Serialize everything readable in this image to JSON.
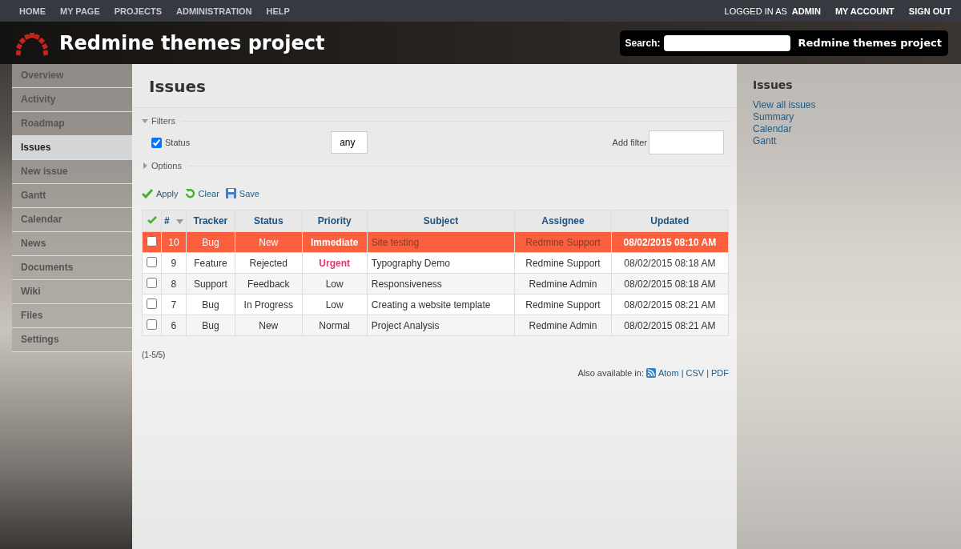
{
  "top_menu": {
    "items": [
      "HOME",
      "MY PAGE",
      "PROJECTS",
      "ADMINISTRATION",
      "HELP"
    ],
    "logged_in_label": "LOGGED IN AS",
    "user": "ADMIN",
    "account_items": [
      "MY ACCOUNT",
      "SIGN OUT"
    ]
  },
  "header": {
    "title": "Redmine themes project",
    "search_label": "Search:",
    "project_jump": "Redmine themes project"
  },
  "main_menu": [
    {
      "label": "Overview",
      "selected": false
    },
    {
      "label": "Activity",
      "selected": false
    },
    {
      "label": "Roadmap",
      "selected": false
    },
    {
      "label": "Issues",
      "selected": true
    },
    {
      "label": "New issue",
      "selected": false
    },
    {
      "label": "Gantt",
      "selected": false
    },
    {
      "label": "Calendar",
      "selected": false
    },
    {
      "label": "News",
      "selected": false
    },
    {
      "label": "Documents",
      "selected": false
    },
    {
      "label": "Wiki",
      "selected": false
    },
    {
      "label": "Files",
      "selected": false
    },
    {
      "label": "Settings",
      "selected": false
    }
  ],
  "page_title": "Issues",
  "filters": {
    "legend": "Filters",
    "expanded": true,
    "status_label": "Status",
    "status_checked": true,
    "status_value": "any",
    "add_filter_label": "Add filter"
  },
  "options": {
    "legend": "Options",
    "expanded": false
  },
  "actions": [
    "Apply",
    "Clear",
    "Save"
  ],
  "table": {
    "columns": [
      "#",
      "Tracker",
      "Status",
      "Priority",
      "Subject",
      "Assignee",
      "Updated"
    ],
    "rows": [
      {
        "kind": "immediate",
        "checked": false,
        "cells": [
          "10",
          "Bug",
          "New",
          "Immediate",
          "Site testing",
          "Redmine Support",
          "08/02/2015 08:10 AM"
        ]
      },
      {
        "kind": "urgent",
        "checked": false,
        "cells": [
          "9",
          "Feature",
          "Rejected",
          "Urgent",
          "Typography Demo",
          "Redmine Support",
          "08/02/2015 08:18 AM"
        ]
      },
      {
        "kind": "normal",
        "checked": false,
        "cells": [
          "8",
          "Support",
          "Feedback",
          "Low",
          "Responsiveness",
          "Redmine Admin",
          "08/02/2015 08:18 AM"
        ]
      },
      {
        "kind": "normal",
        "checked": false,
        "cells": [
          "7",
          "Bug",
          "In Progress",
          "Low",
          "Creating a website template",
          "Redmine Support",
          "08/02/2015 08:21 AM"
        ]
      },
      {
        "kind": "normal",
        "checked": false,
        "cells": [
          "6",
          "Bug",
          "New",
          "Normal",
          "Project Analysis",
          "Redmine Admin",
          "08/02/2015 08:21 AM"
        ]
      }
    ]
  },
  "pagination": "(1-5/5)",
  "other_formats": {
    "label": "Also available in:",
    "links": [
      "Atom",
      "CSV",
      "PDF"
    ],
    "separator": "|"
  },
  "sidebar": {
    "title": "Issues",
    "links": [
      "View all issues",
      "Summary",
      "Calendar",
      "Gantt"
    ]
  }
}
